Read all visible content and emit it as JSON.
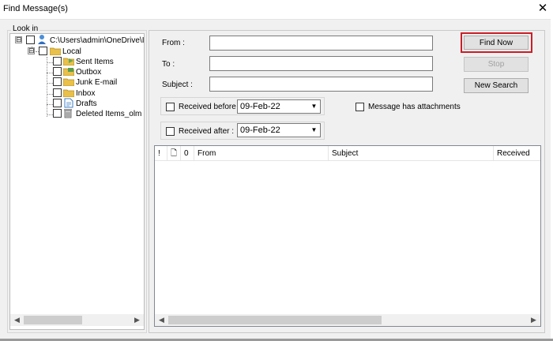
{
  "window": {
    "title": "Find Message(s)",
    "close_glyph": "✕"
  },
  "look_in": {
    "label": "Look in",
    "tree": [
      {
        "label": "C:\\Users\\admin\\OneDrive\\I",
        "icon": "user-folder-icon",
        "expander": "⊟"
      },
      {
        "label": "Local",
        "icon": "folder-icon",
        "expander": "⊟"
      },
      {
        "label": "Sent Items",
        "icon": "sent-items-icon"
      },
      {
        "label": "Outbox",
        "icon": "outbox-icon"
      },
      {
        "label": "Junk E-mail",
        "icon": "junk-mail-icon"
      },
      {
        "label": "Inbox",
        "icon": "inbox-icon"
      },
      {
        "label": "Drafts",
        "icon": "drafts-icon"
      },
      {
        "label": "Deleted Items_olm",
        "icon": "trash-icon"
      }
    ]
  },
  "fields": {
    "from_label": "From :",
    "from_value": "",
    "to_label": "To :",
    "to_value": "",
    "subject_label": "Subject :",
    "subject_value": ""
  },
  "buttons": {
    "find_now": "Find Now",
    "stop": "Stop",
    "new_search": "New Search"
  },
  "options": {
    "received_before_label": "Received before :",
    "received_before_date": "09-Feb-22",
    "received_after_label": "Received after :",
    "received_after_date": "09-Feb-22",
    "attachments_label": "Message has attachments"
  },
  "results": {
    "columns": [
      {
        "label": "!"
      },
      {
        "label": "🗋"
      },
      {
        "label": "0"
      },
      {
        "label": "From"
      },
      {
        "label": "Subject"
      },
      {
        "label": "Received"
      }
    ],
    "rows": []
  },
  "scroll_glyphs": {
    "left": "◀",
    "right": "▶",
    "down": "▼"
  },
  "colors": {
    "highlight_red": "#cc1e26",
    "window_bg": "#f0f0f0",
    "folder_yellow": "#e8c04a"
  }
}
